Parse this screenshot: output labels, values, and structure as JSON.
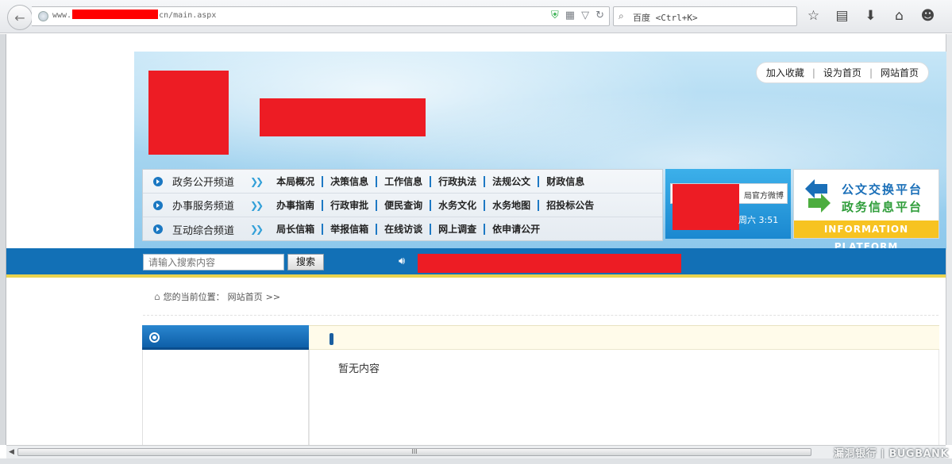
{
  "browser": {
    "url_prefix": "www.",
    "url_suffix": "cn/main.aspx",
    "search_placeholder": "百度 <Ctrl+K>",
    "icons": [
      "back-icon",
      "globe-icon",
      "shield-icon",
      "qr-icon",
      "dropdown-icon",
      "reload-icon",
      "search-icon",
      "star-icon",
      "reading-list-icon",
      "download-icon",
      "home-icon",
      "chat-icon"
    ]
  },
  "header": {
    "toplinks": [
      "加入收藏",
      "设为首页",
      "网站首页"
    ]
  },
  "nav": {
    "rows": [
      {
        "title": "政务公开频道",
        "links": [
          "本局概况",
          "决策信息",
          "工作信息",
          "行政执法",
          "法规公文",
          "财政信息"
        ]
      },
      {
        "title": "办事服务频道",
        "links": [
          "办事指南",
          "行政审批",
          "便民查询",
          "水务文化",
          "水务地图",
          "招投标公告"
        ]
      },
      {
        "title": "互动综合频道",
        "links": [
          "局长信箱",
          "举报信箱",
          "在线访谈",
          "网上调查",
          "依申请公开"
        ]
      }
    ]
  },
  "weibo": {
    "label": "局官方微博",
    "time": "周六 3:51"
  },
  "platform": {
    "line1": "公文交换平台",
    "line2": "政务信息平台",
    "band": "INFORMATION PLATFORM"
  },
  "search": {
    "placeholder": "请输入搜索内容",
    "button": "搜索"
  },
  "breadcrumb": {
    "prefix": "您的当前位置：",
    "current": "网站首页",
    "arrows": ">>"
  },
  "content": {
    "empty_text": "暂无内容"
  },
  "statusbar": {
    "scroll_grip": "III"
  },
  "watermark": "漏洞银行 | BUGBANK",
  "colors": {
    "brand_blue": "#1270b6",
    "redaction": "#ed1c24",
    "accent_yellow": "#f7c321"
  }
}
